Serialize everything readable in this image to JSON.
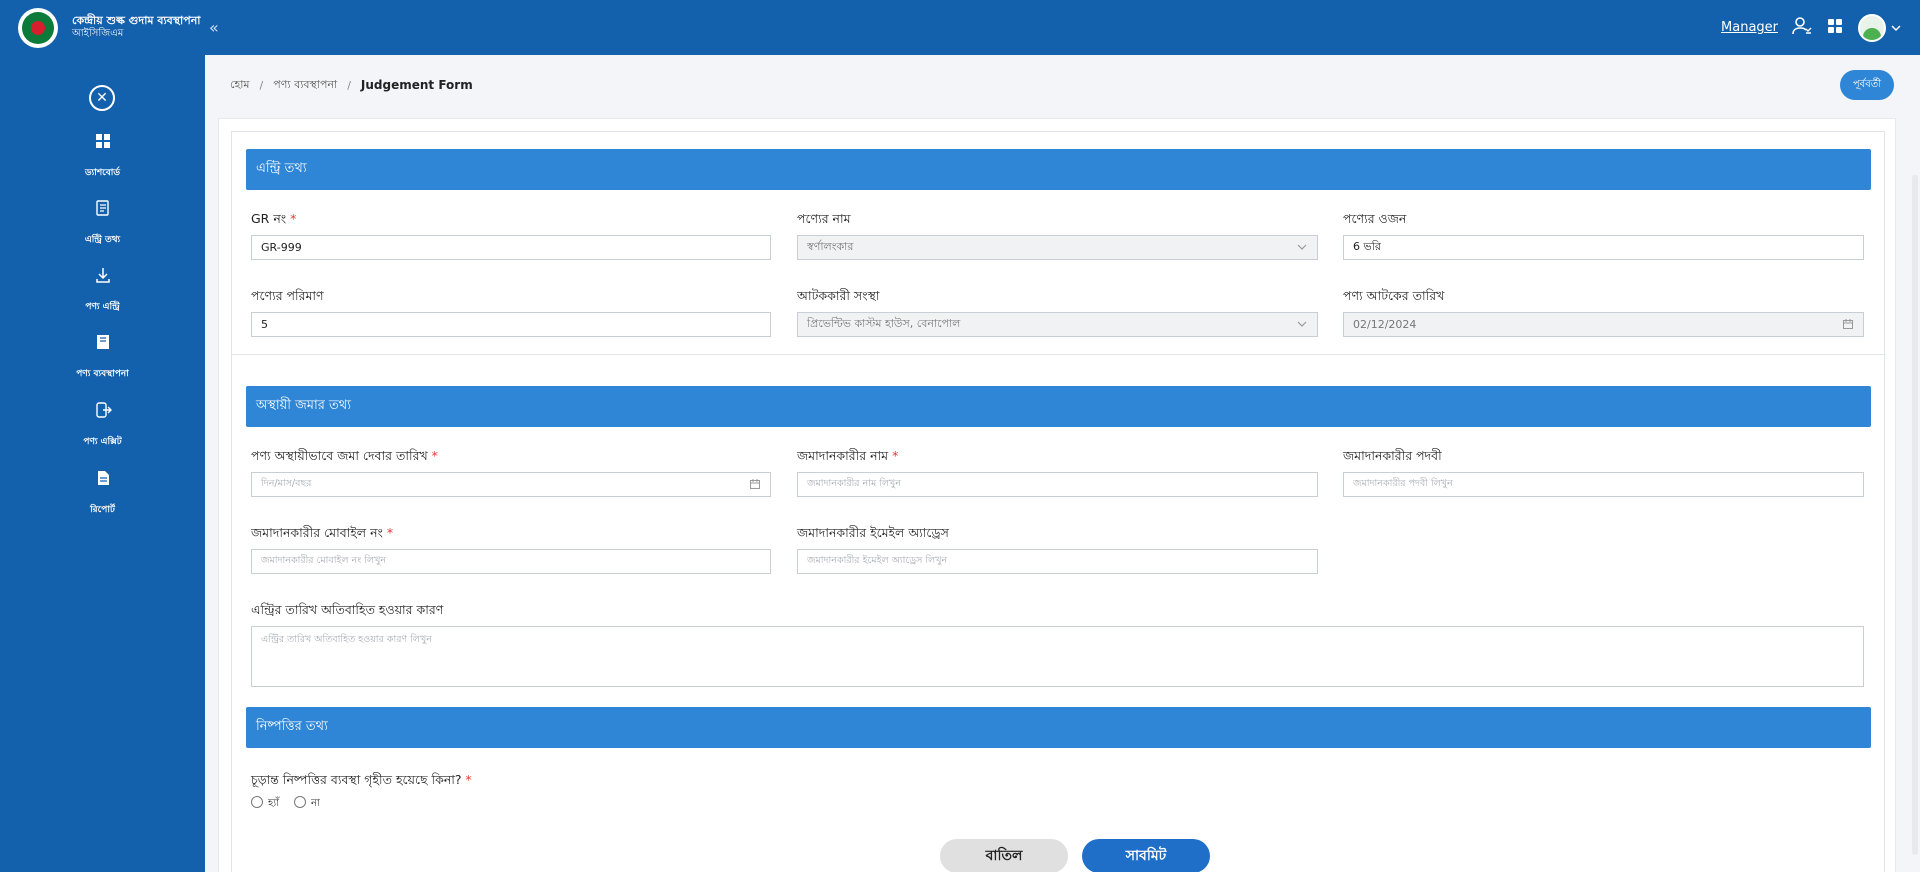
{
  "header": {
    "app_title": "কেন্দ্রীয় শুল্ক গুদাম ব্যবস্থাপনা",
    "app_subtitle": "আইসিজিএম",
    "collapse_glyph": "«",
    "user_link": "Manager",
    "icons": [
      "logo",
      "collapse-icon",
      "user-settings-icon",
      "apps-grid-icon",
      "avatar",
      "chevron-down-icon"
    ]
  },
  "sidebar": {
    "close_glyph": "✕",
    "items": [
      {
        "label": "ড্যাশবোর্ড",
        "icon": "dashboard-icon"
      },
      {
        "label": "এন্ট্রি তথ্য",
        "icon": "entry-icon"
      },
      {
        "label": "পণ্য এন্ট্রি",
        "icon": "download-icon"
      },
      {
        "label": "পণ্য ব্যবস্থাপনা",
        "icon": "book-icon"
      },
      {
        "label": "পণ্য এক্সিট",
        "icon": "exit-icon"
      },
      {
        "label": "রিপোর্ট",
        "icon": "report-icon"
      }
    ]
  },
  "breadcrumb": {
    "home": "হোম",
    "parent": "পণ্য ব্যবস্থাপনা",
    "current": "Judgement Form",
    "separator": "/"
  },
  "back_button": "পূর্ববর্তী",
  "entry_section": {
    "title": "এন্ট্রি তথ্য",
    "gr_no": {
      "label": "GR নং",
      "value": "GR-999"
    },
    "product_name": {
      "label": "পণ্যের নাম",
      "value": "স্বর্ণালংকার"
    },
    "product_weight": {
      "label": "পণ্যের ওজন",
      "value": "6 ভরি"
    },
    "product_quantity": {
      "label": "পণ্যের পরিমাণ",
      "value": "5"
    },
    "seizing_agency": {
      "label": "আটককারী সংস্থা",
      "value": "প্রিভেন্টিভ কাস্টম হাউস, বেনাপোল"
    },
    "seizure_date": {
      "label": "পণ্য আটকের তারিখ",
      "value": "02/12/2024"
    }
  },
  "deposit_section": {
    "title": "অস্থায়ী জমার তথ্য",
    "deposit_date": {
      "label": "পণ্য অস্থায়ীভাবে জমা দেবার তারিখ",
      "placeholder": "দিন/মাস/বছর"
    },
    "depositor_name": {
      "label": "জমাদানকারীর নাম",
      "placeholder": "জমাদানকারীর নাম লিখুন"
    },
    "depositor_designation": {
      "label": "জমাদানকারীর পদবী",
      "placeholder": "জমাদানকারীর পদবী লিখুন"
    },
    "depositor_mobile": {
      "label": "জমাদানকারীর মোবাইল নং",
      "placeholder": "জমাদানকারীর মোবাইল নং লিখুন"
    },
    "depositor_email": {
      "label": "জমাদানকারীর ইমেইল অ্যাড্রেস",
      "placeholder": "জমাদানকারীর ইমেইল অ্যাড্রেস লিখুন"
    },
    "overdue_reason": {
      "label": "এন্ট্রির তারিখ অতিবাহিত হওয়ার কারণ",
      "placeholder": "এন্ট্রির তারিখ অতিবাহিত হওয়ার কারণ লিখুন"
    }
  },
  "settlement_section": {
    "title": "নিষ্পত্তির তথ্য",
    "question": "চূড়ান্ত নিষ্পত্তির ব্যবস্থা গৃহীত হয়েছে কিনা?",
    "yes": "হ্যাঁ",
    "no": "না"
  },
  "required_mark": "*",
  "actions": {
    "cancel": "বাতিল",
    "submit": "সাবমিট"
  },
  "colors": {
    "primary": "#1360ad",
    "section": "#2f86d6",
    "required": "#e53935"
  }
}
